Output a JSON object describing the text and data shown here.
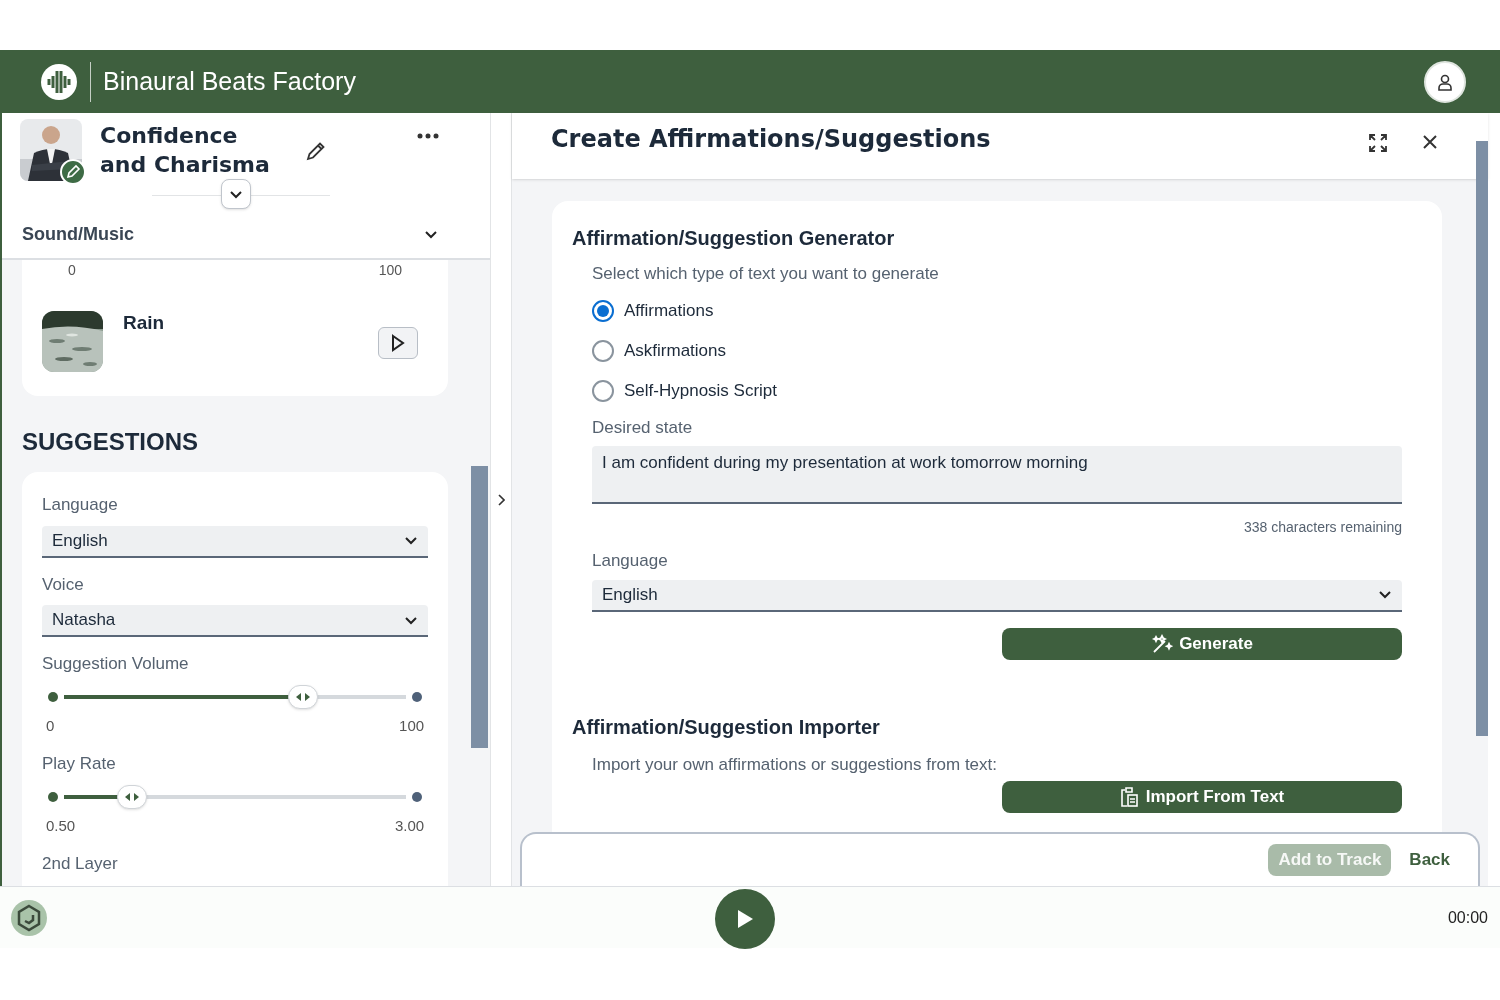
{
  "app": {
    "title": "Binaural Beats Factory"
  },
  "track": {
    "title": "Confidence and Charisma"
  },
  "sound_section": {
    "label": "Sound/Music",
    "expanded": true,
    "range_min": "0",
    "range_max": "100",
    "sounds": [
      {
        "name": "Rain",
        "kind": "picture"
      }
    ]
  },
  "suggestions": {
    "heading": "SUGGESTIONS",
    "fields": [
      {
        "kind": "select",
        "label": "Language",
        "value": "English"
      },
      {
        "kind": "select",
        "label": "Voice",
        "value": "Natasha"
      },
      {
        "kind": "slider",
        "label": "Suggestion Volume",
        "level": 0.7,
        "min": "0",
        "max": "100"
      },
      {
        "kind": "slider",
        "label": "Play Rate",
        "level": 0.2,
        "min": "0.50",
        "max": "3.00"
      },
      {
        "kind": "label",
        "label": "2nd Layer"
      }
    ]
  },
  "dialog": {
    "title": "Create Affirmations/Suggestions",
    "generator": {
      "heading": "Affirmation/Suggestion Generator",
      "prompt": "Select which type of text you want to generate",
      "options": [
        {
          "label": "Affirmations",
          "selected": true
        },
        {
          "label": "Askfirmations",
          "selected": false
        },
        {
          "label": "Self-Hypnosis Script",
          "selected": false
        }
      ],
      "desired_label": "Desired state",
      "desired_value": "I am confident during my presentation at work tomorrow morning",
      "remaining": "338 characters remaining",
      "language_label": "Language",
      "language_value": "English",
      "generate_button": "Generate"
    },
    "importer": {
      "heading": "Affirmation/Suggestion Importer",
      "prompt": "Import your own affirmations or suggestions from text:",
      "button": "Import From Text"
    },
    "footer": [
      {
        "label": "Add to Track",
        "disabled": true
      },
      {
        "label": "Back",
        "disabled": false
      }
    ]
  },
  "player": {
    "time": "00:00"
  }
}
